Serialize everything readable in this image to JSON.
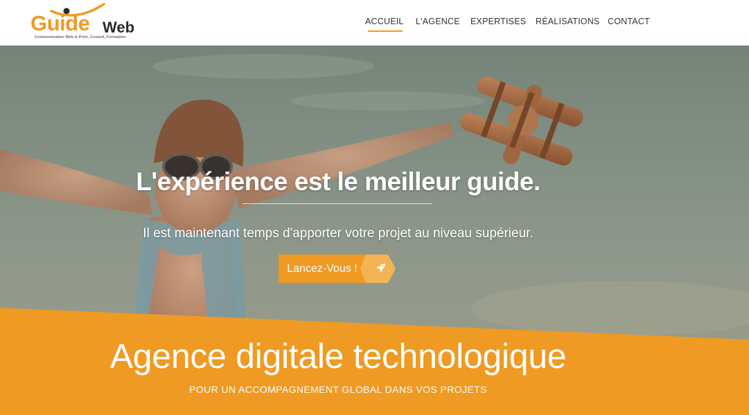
{
  "brand": {
    "logo_part1": "Guide",
    "logo_part2": "Web",
    "tagline": "Communication Web & Print, Conseil, Formation",
    "accent_color": "#ef9a23"
  },
  "nav": {
    "items": [
      {
        "label": "ACCUEIL",
        "active": true
      },
      {
        "label": "L'AGENCE",
        "active": false
      },
      {
        "label": "EXPERTISES",
        "active": false
      },
      {
        "label": "RÉALISATIONS",
        "active": false
      },
      {
        "label": "CONTACT",
        "active": false
      }
    ]
  },
  "hero": {
    "title": "L'expérience est le meilleur guide.",
    "subtitle": "Il est maintenant temps d'apporter votre projet au niveau supérieur.",
    "cta_label": "Lancez-Vous !",
    "cta_icon": "rocket-icon"
  },
  "band": {
    "title": "Agence digitale technologique",
    "subtitle": "POUR UN ACCOMPAGNEMENT GLOBAL DANS VOS PROJETS",
    "color": "#ef9a23"
  }
}
